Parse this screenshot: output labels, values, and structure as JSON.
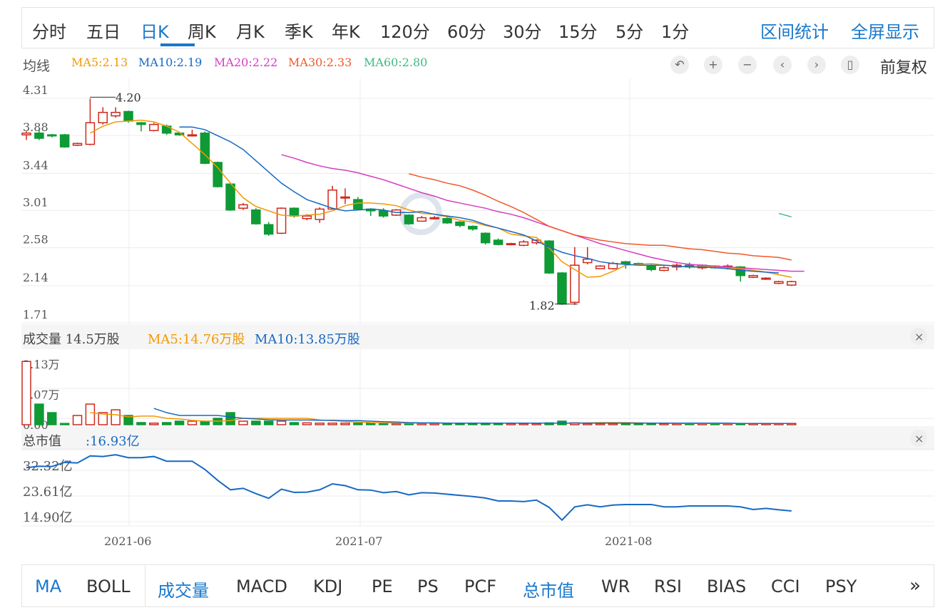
{
  "period_tabs": [
    "分时",
    "五日",
    "日K",
    "周K",
    "月K",
    "季K",
    "年K",
    "120分",
    "60分",
    "30分",
    "15分",
    "5分",
    "1分"
  ],
  "active_tab": "日K",
  "right_actions": [
    "区间统计",
    "全屏显示"
  ],
  "ma_bar": {
    "title": "均线",
    "items": [
      {
        "label": "MA5:2.13",
        "color": "#f39800"
      },
      {
        "label": "MA10:2.19",
        "color": "#1769c4"
      },
      {
        "label": "MA20:2.22",
        "color": "#d63cc1"
      },
      {
        "label": "MA30:2.33",
        "color": "#f0582a"
      },
      {
        "label": "MA60:2.80",
        "color": "#3dbb80"
      }
    ],
    "controls": [
      "undo-icon",
      "zoom-in-icon",
      "zoom-out-icon",
      "chevron-left-icon",
      "chevron-right-icon",
      "candlestick-icon"
    ],
    "adjust_label": "前复权"
  },
  "volume_bar": {
    "title": "成交量 14.5万股",
    "ma5": "MA5:14.76万股",
    "ma10": "MA10:13.85万股",
    "ma5_color": "#f39800",
    "ma10_color": "#1769c4"
  },
  "mcap_bar": {
    "title": "总市值",
    "value": ":16.93亿"
  },
  "bottom_tabs": [
    {
      "label": "MA",
      "active": true
    },
    {
      "label": "BOLL",
      "active": false
    },
    {
      "label": "成交量",
      "active": true
    },
    {
      "label": "MACD",
      "active": false
    },
    {
      "label": "KDJ",
      "active": false
    },
    {
      "label": "PE",
      "active": false
    },
    {
      "label": "PS",
      "active": false
    },
    {
      "label": "PCF",
      "active": false
    },
    {
      "label": "总市值",
      "active": true
    },
    {
      "label": "WR",
      "active": false
    },
    {
      "label": "RSI",
      "active": false
    },
    {
      "label": "BIAS",
      "active": false
    },
    {
      "label": "CCI",
      "active": false
    },
    {
      "label": "PSY",
      "active": false
    }
  ],
  "more_label": "»",
  "chart_data": [
    {
      "type": "candlestick",
      "y_ticks": [
        "4.31",
        "3.88",
        "3.44",
        "3.01",
        "2.58",
        "2.14",
        "1.71"
      ],
      "ylim": [
        1.71,
        4.31
      ],
      "x_ticks": [
        "2021-06",
        "2021-07",
        "2021-08"
      ],
      "annotations": [
        {
          "label": "4.20",
          "value": 4.2
        },
        {
          "label": "1.82",
          "value": 1.82
        }
      ],
      "ohlc": [
        [
          3.78,
          3.8,
          3.72,
          3.82
        ],
        [
          3.8,
          3.74,
          3.72,
          3.85
        ],
        [
          3.78,
          3.77,
          3.75,
          3.79
        ],
        [
          3.78,
          3.64,
          3.63,
          3.79
        ],
        [
          3.66,
          3.68,
          3.65,
          3.69
        ],
        [
          3.67,
          3.92,
          3.66,
          4.2
        ],
        [
          3.92,
          4.04,
          3.9,
          4.1
        ],
        [
          4.0,
          4.04,
          3.98,
          4.1
        ],
        [
          4.05,
          3.94,
          3.92,
          4.06
        ],
        [
          3.92,
          3.9,
          3.82,
          3.93
        ],
        [
          3.83,
          3.9,
          3.82,
          3.92
        ],
        [
          3.88,
          3.8,
          3.78,
          3.9
        ],
        [
          3.8,
          3.78,
          3.77,
          3.8
        ],
        [
          3.78,
          3.78,
          3.76,
          3.84
        ],
        [
          3.8,
          3.45,
          3.44,
          3.82
        ],
        [
          3.46,
          3.18,
          3.17,
          3.47
        ],
        [
          3.21,
          2.91,
          2.9,
          3.22
        ],
        [
          2.93,
          2.97,
          2.91,
          2.99
        ],
        [
          2.91,
          2.75,
          2.74,
          2.93
        ],
        [
          2.74,
          2.63,
          2.61,
          2.77
        ],
        [
          2.64,
          2.93,
          2.63,
          2.94
        ],
        [
          2.93,
          2.84,
          2.82,
          2.94
        ],
        [
          2.81,
          2.84,
          2.79,
          2.86
        ],
        [
          2.8,
          2.92,
          2.76,
          2.94
        ],
        [
          2.92,
          3.14,
          2.92,
          3.19
        ],
        [
          3.05,
          3.06,
          2.98,
          3.16
        ],
        [
          3.03,
          2.92,
          2.91,
          3.06
        ],
        [
          2.92,
          2.9,
          2.84,
          2.93
        ],
        [
          2.9,
          2.84,
          2.82,
          2.93
        ],
        [
          2.85,
          2.91,
          2.84,
          2.92
        ],
        [
          2.85,
          2.75,
          2.74,
          2.86
        ],
        [
          2.78,
          2.82,
          2.78,
          2.84
        ],
        [
          2.82,
          2.82,
          2.8,
          2.84
        ],
        [
          2.81,
          2.76,
          2.75,
          2.83
        ],
        [
          2.77,
          2.73,
          2.71,
          2.78
        ],
        [
          2.72,
          2.69,
          2.67,
          2.73
        ],
        [
          2.64,
          2.53,
          2.51,
          2.65
        ],
        [
          2.56,
          2.51,
          2.5,
          2.58
        ],
        [
          2.52,
          2.52,
          2.5,
          2.53
        ],
        [
          2.5,
          2.54,
          2.49,
          2.56
        ],
        [
          2.53,
          2.56,
          2.51,
          2.57
        ],
        [
          2.55,
          2.18,
          2.17,
          2.56
        ],
        [
          2.18,
          1.82,
          1.81,
          2.19
        ],
        [
          1.84,
          2.27,
          1.81,
          2.48
        ],
        [
          2.3,
          2.34,
          2.28,
          2.48
        ],
        [
          2.23,
          2.26,
          2.23,
          2.27
        ],
        [
          2.23,
          2.29,
          2.22,
          2.31
        ],
        [
          2.31,
          2.29,
          2.23,
          2.32
        ],
        [
          2.29,
          2.28,
          2.27,
          2.3
        ],
        [
          2.26,
          2.22,
          2.2,
          2.28
        ],
        [
          2.21,
          2.24,
          2.2,
          2.26
        ],
        [
          2.25,
          2.27,
          2.21,
          2.29
        ],
        [
          2.27,
          2.25,
          2.23,
          2.3
        ],
        [
          2.24,
          2.27,
          2.22,
          2.28
        ],
        [
          2.26,
          2.24,
          2.23,
          2.27
        ],
        [
          2.24,
          2.26,
          2.22,
          2.28
        ],
        [
          2.25,
          2.15,
          2.08,
          2.26
        ],
        [
          2.13,
          2.15,
          2.12,
          2.16
        ],
        [
          2.11,
          2.12,
          2.1,
          2.13
        ],
        [
          2.06,
          2.08,
          2.05,
          2.09
        ],
        [
          2.04,
          2.08,
          2.03,
          2.09
        ]
      ],
      "series": [
        {
          "name": "MA5",
          "color": "#f39800",
          "start": 5,
          "values": [
            3.8,
            3.88,
            3.93,
            3.94,
            3.95,
            3.93,
            3.88,
            3.81,
            3.68,
            3.55,
            3.4,
            3.22,
            3.05,
            2.95,
            2.9,
            2.85,
            2.84,
            2.85,
            2.86,
            2.9,
            2.96,
            2.99,
            2.99,
            2.98,
            2.96,
            2.91,
            2.87,
            2.86,
            2.83,
            2.79,
            2.77,
            2.73,
            2.7,
            2.63,
            2.61,
            2.59,
            2.47,
            2.31,
            2.22,
            2.13,
            2.14,
            2.2,
            2.27,
            2.28,
            2.29,
            2.27,
            2.26,
            2.25,
            2.26,
            2.25,
            2.24,
            2.23,
            2.21,
            2.19,
            2.16,
            2.13
          ]
        },
        {
          "name": "MA10",
          "color": "#1769c4",
          "start": 12,
          "values": [
            3.87,
            3.87,
            3.84,
            3.77,
            3.7,
            3.61,
            3.48,
            3.35,
            3.22,
            3.12,
            3.03,
            2.98,
            2.93,
            2.9,
            2.91,
            2.92,
            2.91,
            2.88,
            2.88,
            2.89,
            2.86,
            2.84,
            2.82,
            2.79,
            2.74,
            2.7,
            2.66,
            2.62,
            2.55,
            2.48,
            2.42,
            2.38,
            2.35,
            2.31,
            2.29,
            2.28,
            2.27,
            2.27,
            2.27,
            2.26,
            2.25,
            2.25,
            2.24,
            2.23,
            2.21,
            2.2,
            2.19,
            2.18
          ]
        },
        {
          "name": "MA20",
          "color": "#d63cc1",
          "start": 20,
          "values": [
            3.55,
            3.51,
            3.46,
            3.42,
            3.39,
            3.37,
            3.34,
            3.3,
            3.26,
            3.21,
            3.16,
            3.11,
            3.07,
            3.02,
            2.99,
            2.96,
            2.93,
            2.89,
            2.86,
            2.82,
            2.77,
            2.72,
            2.67,
            2.62,
            2.57,
            2.52,
            2.48,
            2.44,
            2.4,
            2.36,
            2.33,
            2.3,
            2.28,
            2.27,
            2.26,
            2.25,
            2.24,
            2.23,
            2.22,
            2.21,
            2.2,
            2.2
          ]
        },
        {
          "name": "MA30",
          "color": "#f0582a",
          "start": 30,
          "values": [
            3.33,
            3.29,
            3.26,
            3.22,
            3.19,
            3.14,
            3.08,
            3.01,
            2.95,
            2.88,
            2.8,
            2.72,
            2.67,
            2.62,
            2.59,
            2.56,
            2.54,
            2.52,
            2.51,
            2.5,
            2.5,
            2.48,
            2.46,
            2.45,
            2.43,
            2.41,
            2.4,
            2.38,
            2.37,
            2.36,
            2.33
          ]
        },
        {
          "name": "MA60",
          "color": "#3dbb80",
          "start": 59,
          "values": [
            2.87,
            2.83
          ]
        }
      ]
    },
    {
      "type": "bar",
      "y_ticks": [
        "2.13万",
        "1.07万",
        "0.00"
      ],
      "ylim": [
        0,
        2.13
      ],
      "values": [
        2.2,
        0.7,
        0.4,
        0.02,
        0.3,
        0.7,
        0.4,
        0.5,
        0.3,
        0.05,
        0.03,
        0.05,
        0.1,
        0.1,
        0.1,
        0.2,
        0.4,
        0.1,
        0.1,
        0.1,
        0.1,
        0.05,
        0.04,
        0.03,
        0.03,
        0.03,
        0.03,
        0.03,
        0.02,
        0.02,
        0.03,
        0.02,
        0.02,
        0.02,
        0.02,
        0.02,
        0.02,
        0.02,
        0.02,
        0.02,
        0.02,
        0.04,
        0.1,
        0.04,
        0.02,
        0.02,
        0.02,
        0.02,
        0.02,
        0.02,
        0.02,
        0.02,
        0.02,
        0.02,
        0.02,
        0.02,
        0.02,
        0.02,
        0.02,
        0.02,
        0.02
      ],
      "series": [
        {
          "name": "MA5",
          "color": "#f39800",
          "start": 5,
          "values": [
            0.4,
            0.35,
            0.33,
            0.25,
            0.28,
            0.28,
            0.2,
            0.18,
            0.13,
            0.1,
            0.1,
            0.12,
            0.2,
            0.2,
            0.2,
            0.2,
            0.2,
            0.2,
            0.14,
            0.12,
            0.09,
            0.07,
            0.05,
            0.04,
            0.04,
            0.03,
            0.03,
            0.03,
            0.03,
            0.03,
            0.03,
            0.03,
            0.03,
            0.03,
            0.03,
            0.03,
            0.03,
            0.03,
            0.03,
            0.04,
            0.05,
            0.05,
            0.05,
            0.04,
            0.03,
            0.03,
            0.02,
            0.02,
            0.02,
            0.02,
            0.02,
            0.02,
            0.02,
            0.02,
            0.02,
            0.02
          ]
        },
        {
          "name": "MA10",
          "color": "#1769c4",
          "start": 10,
          "values": [
            0.55,
            0.4,
            0.3,
            0.3,
            0.3,
            0.3,
            0.25,
            0.2,
            0.18,
            0.15,
            0.14,
            0.14,
            0.14,
            0.13,
            0.13,
            0.12,
            0.12,
            0.1,
            0.08,
            0.07,
            0.05,
            0.04,
            0.04,
            0.03,
            0.03,
            0.03,
            0.03,
            0.03,
            0.03,
            0.03,
            0.03,
            0.03,
            0.03,
            0.03,
            0.03,
            0.03,
            0.03,
            0.03,
            0.03,
            0.03,
            0.03,
            0.03,
            0.03,
            0.03,
            0.03,
            0.03,
            0.02,
            0.02,
            0.02,
            0.02,
            0.02
          ]
        }
      ]
    },
    {
      "type": "line",
      "y_ticks": [
        "32.32亿",
        "23.61亿",
        "14.90亿"
      ],
      "ylim": [
        14.9,
        32.32
      ],
      "series": [
        {
          "name": "总市值",
          "color": "#1769c4",
          "values": [
            30.8,
            31.3,
            31.2,
            32.6,
            32.4,
            34.8,
            34.6,
            35.2,
            34.2,
            34.2,
            34.6,
            33.0,
            33.0,
            33.0,
            30.2,
            26.5,
            23.3,
            23.8,
            22.0,
            20.4,
            23.5,
            22.4,
            22.5,
            23.3,
            25.3,
            24.7,
            23.3,
            23.2,
            22.3,
            22.7,
            21.6,
            22.3,
            22.2,
            21.8,
            21.4,
            21.0,
            20.5,
            19.5,
            19.5,
            19.3,
            19.8,
            17.3,
            13.0,
            17.5,
            18.2,
            17.5,
            18.1,
            18.3,
            18.3,
            18.3,
            17.5,
            17.5,
            17.8,
            17.8,
            17.8,
            17.8,
            17.5,
            16.6,
            17.0,
            16.5,
            16.1
          ]
        }
      ]
    }
  ]
}
